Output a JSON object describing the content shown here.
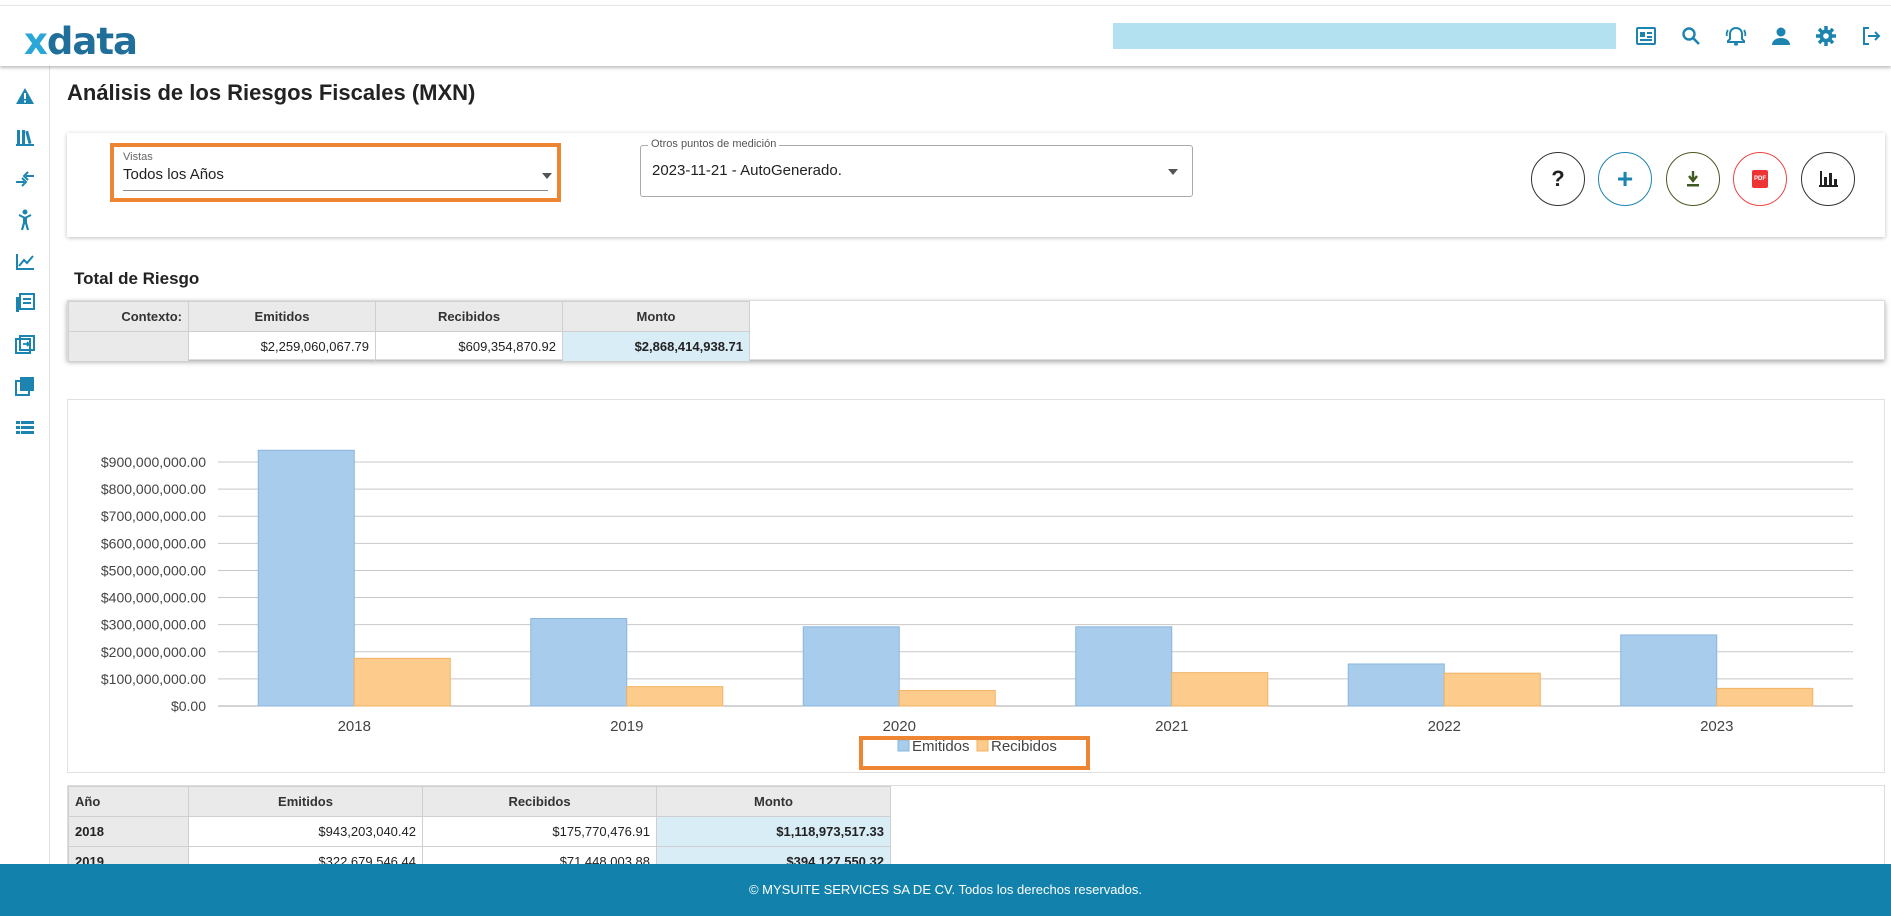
{
  "app": {
    "logo_prefix": "x",
    "logo_text": "data",
    "search_value": ""
  },
  "topbar_icons": [
    "newspaper-icon",
    "search-icon",
    "alarm-bell-icon",
    "user-icon",
    "gear-icon",
    "logout-icon"
  ],
  "sidebar_icons": [
    "warning-icon",
    "library-icon",
    "compare-arrows-icon",
    "person-icon",
    "line-chart-icon",
    "document-list-icon",
    "transfer-icon",
    "copy-icon",
    "list-icon"
  ],
  "page": {
    "title": "Análisis de los Riesgos Fiscales (MXN)"
  },
  "filters": {
    "vistas_label": "Vistas",
    "vistas_value": "Todos los Años",
    "otros_label": "Otros puntos de medición",
    "otros_value": "2023-11-21 - AutoGenerado."
  },
  "actions": {
    "help": "?",
    "add": "+",
    "download": "⬇",
    "pdf": "PDF",
    "chart": "chart-icon"
  },
  "colors": {
    "accent": "#1282ac",
    "emitidos": "#a8cdec",
    "recibidos": "#fdcb8c",
    "highlight": "#ee8533"
  },
  "total": {
    "section_title": "Total de Riesgo",
    "headers": [
      "Contexto:",
      "Emitidos",
      "Recibidos",
      "Monto"
    ],
    "row": [
      "",
      "$2,259,060,067.79",
      "$609,354,870.92",
      "$2,868,414,938.71"
    ]
  },
  "chart_data": {
    "type": "bar",
    "categories": [
      "2018",
      "2019",
      "2020",
      "2021",
      "2022",
      "2023"
    ],
    "series": [
      {
        "name": "Emitidos",
        "values": [
          943203040.42,
          322679546.44,
          292000000,
          292000000,
          155000000,
          262000000
        ]
      },
      {
        "name": "Recibidos",
        "values": [
          175770476.91,
          71448003.88,
          57000000,
          123000000,
          121000000,
          65000000
        ]
      }
    ],
    "ylim": [
      0,
      900000000
    ],
    "yticks": [
      "$0.00",
      "$100,000,000.00",
      "$200,000,000.00",
      "$300,000,000.00",
      "$400,000,000.00",
      "$500,000,000.00",
      "$600,000,000.00",
      "$700,000,000.00",
      "$800,000,000.00",
      "$900,000,000.00"
    ],
    "grid": true,
    "legend": "bottom-center"
  },
  "table": {
    "headers": [
      "Año",
      "Emitidos",
      "Recibidos",
      "Monto"
    ],
    "rows": [
      [
        "2018",
        "$943,203,040.42",
        "$175,770,476.91",
        "$1,118,973,517.33"
      ],
      [
        "2019",
        "$322,679,546.44",
        "$71,448,003.88",
        "$394,127,550.32"
      ]
    ]
  },
  "footer": {
    "text": "© MYSUITE SERVICES SA DE CV. Todos los derechos reservados."
  }
}
